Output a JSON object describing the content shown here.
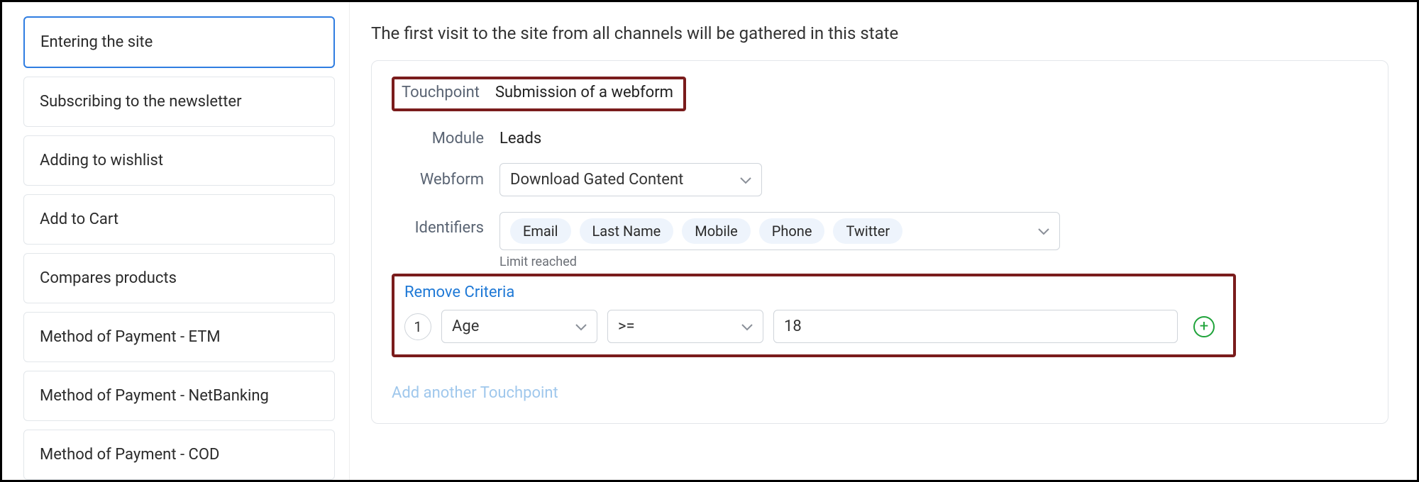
{
  "sidebar": {
    "items": [
      {
        "label": "Entering the site",
        "active": true
      },
      {
        "label": "Subscribing to the newsletter"
      },
      {
        "label": "Adding to wishlist"
      },
      {
        "label": "Add to Cart"
      },
      {
        "label": "Compares products"
      },
      {
        "label": "Method of Payment - ETM"
      },
      {
        "label": "Method of Payment - NetBanking"
      },
      {
        "label": "Method of Payment - COD"
      }
    ]
  },
  "main": {
    "heading": "The first visit to the site from all channels will be gathered in this state",
    "touchpoint": {
      "label": "Touchpoint",
      "value": "Submission of a webform"
    },
    "module": {
      "label": "Module",
      "value": "Leads"
    },
    "webform": {
      "label": "Webform",
      "value": "Download Gated Content"
    },
    "identifiers": {
      "label": "Identifiers",
      "chips": [
        "Email",
        "Last Name",
        "Mobile",
        "Phone",
        "Twitter"
      ],
      "limit": "Limit reached"
    },
    "criteria": {
      "remove_label": "Remove Criteria",
      "number": "1",
      "field": "Age",
      "operator": ">=",
      "value": "18"
    },
    "add_another": "Add another Touchpoint"
  }
}
